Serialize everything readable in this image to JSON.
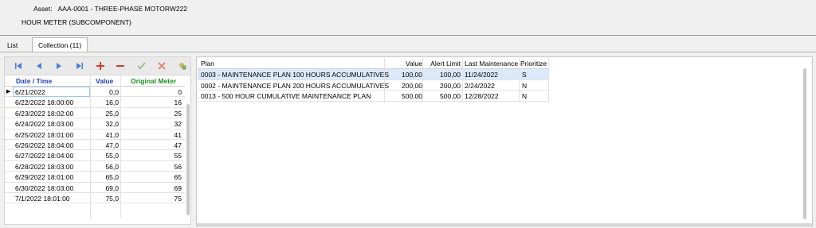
{
  "header": {
    "asset_label": "Asset:",
    "asset_value": "AAA-0001 - THREE-PHASE MOTORW222",
    "subcomponent": "HOUR METER (SUBCOMPONENT)"
  },
  "tabs": [
    {
      "label": "List",
      "active": false
    },
    {
      "label": "Collection (11)",
      "active": true
    }
  ],
  "toolbar": {
    "buttons": [
      {
        "name": "first-icon",
        "glyph": "first"
      },
      {
        "name": "prev-icon",
        "glyph": "prev"
      },
      {
        "name": "next-icon",
        "glyph": "next"
      },
      {
        "name": "last-icon",
        "glyph": "last"
      },
      {
        "name": "add-icon",
        "glyph": "plus"
      },
      {
        "name": "remove-icon",
        "glyph": "minus"
      },
      {
        "name": "confirm-icon",
        "glyph": "check"
      },
      {
        "name": "cancel-icon",
        "glyph": "cross"
      },
      {
        "name": "refresh-icon",
        "glyph": "refresh"
      }
    ],
    "colors": {
      "nav": "#4a7fd6",
      "plus": "#d83a2a",
      "minus": "#d83a2a",
      "check": "#9bc28e",
      "cross": "#e08a80"
    }
  },
  "readings": {
    "headers": {
      "date": "Date / Time",
      "value": "Value",
      "original": "Original Meter"
    },
    "header_colors": {
      "date": "#1a3fb5",
      "value": "#1a3fb5",
      "original": "#1a8f1a"
    },
    "rows": [
      {
        "date": "6/21/2022",
        "value": "0,0",
        "original": "0",
        "current": true
      },
      {
        "date": "6/22/2022 18:00:00",
        "value": "16,0",
        "original": "16"
      },
      {
        "date": "6/23/2022 18:02:00",
        "value": "25,0",
        "original": "25"
      },
      {
        "date": "6/24/2022 18:03:00",
        "value": "32,0",
        "original": "32"
      },
      {
        "date": "6/25/2022 18:01:00",
        "value": "41,0",
        "original": "41"
      },
      {
        "date": "6/26/2022 18:04:00",
        "value": "47,0",
        "original": "47"
      },
      {
        "date": "6/27/2022 18:04:00",
        "value": "55,0",
        "original": "55"
      },
      {
        "date": "6/28/2022 18:03:00",
        "value": "56,0",
        "original": "56"
      },
      {
        "date": "6/29/2022 18:01:00",
        "value": "65,0",
        "original": "65"
      },
      {
        "date": "6/30/2022 18:03:00",
        "value": "69,0",
        "original": "69"
      },
      {
        "date": "7/1/2022 18:01:00",
        "value": "75,0",
        "original": "75"
      }
    ]
  },
  "plans": {
    "headers": {
      "plan": "Plan",
      "value": "Value",
      "alert": "Alert Limit",
      "last": "Last Maintenance",
      "prioritize": "Prioritize"
    },
    "rows": [
      {
        "plan": "0003 - MAINTENANCE PLAN 100 HOURS ACCUMULATIVES",
        "value": "100,00",
        "alert": "100,00",
        "last": "11/24/2022",
        "prioritize": "S",
        "selected": true
      },
      {
        "plan": "0002 - MAINTENANCE PLAN 200 HOURS ACCUMULATIVES",
        "value": "200,00",
        "alert": "200,00",
        "last": "2/24/2022",
        "prioritize": "N"
      },
      {
        "plan": "0013 - 500 HOUR CUMULATIVE MAINTENANCE PLAN",
        "value": "500,00",
        "alert": "500,00",
        "last": "12/28/2022",
        "prioritize": "N"
      }
    ]
  }
}
